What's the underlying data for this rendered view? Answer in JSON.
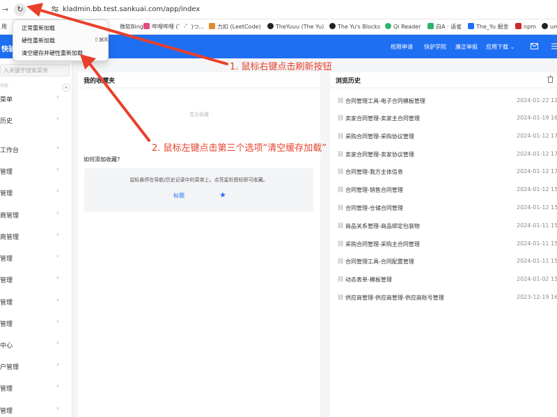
{
  "browser": {
    "url": "kladmin.bb.test.sankuai.com/app/index",
    "back_icon": "back-arrow-icon",
    "forward_icon": "forward-arrow-icon",
    "reload_icon": "reload-icon",
    "site_info_icon": "site-info-icon"
  },
  "bookmarks": [
    {
      "label": "用",
      "icon": "bookmark-icon",
      "color": "#999999"
    },
    {
      "label": "微软Bing",
      "icon": "bookmark-icon",
      "color": "#ffffff"
    },
    {
      "label": "哔哩哔哩 (゜-゜)つ...",
      "icon": "bilibili-icon",
      "color": "#e24d7e"
    },
    {
      "label": "力扣 (LeetCode)",
      "icon": "leetcode-icon",
      "color": "#e08a2e"
    },
    {
      "label": "TheYuuu (The Yu)",
      "icon": "github-icon",
      "color": "#222222"
    },
    {
      "label": "The Yu's Blocks",
      "icon": "github-icon",
      "color": "#222222"
    },
    {
      "label": "Qi Reader",
      "icon": "qi-reader-icon",
      "color": "#2fb36b"
    },
    {
      "label": "白A · 语雀",
      "icon": "yuque-icon",
      "color": "#2fb36b"
    },
    {
      "label": "The_Yu 掘金",
      "icon": "juejin-icon",
      "color": "#1f6ff3"
    },
    {
      "label": "npm",
      "icon": "npm-icon",
      "color": "#cb2b2b"
    },
    {
      "label": "umy",
      "icon": "github-icon",
      "color": "#222222"
    }
  ],
  "context_menu": {
    "items": [
      {
        "label": "正常重新加载",
        "shortcut": ""
      },
      {
        "label": "硬性重新加载",
        "shortcut": "⇧⌘R"
      },
      {
        "label": "清空缓存并硬性重新加载",
        "shortcut": ""
      }
    ]
  },
  "header": {
    "logo": "快驴",
    "nav": [
      "权限申请",
      "快驴学院",
      "廉正举报",
      "应用下载 ⌄"
    ],
    "mail_icon": "mail-icon",
    "more_icon": "collapse-icon"
  },
  "sidebar": {
    "search_placeholder": "入关键字搜索菜单",
    "section_label": "功能",
    "collapse_icon": "double-chevron-left-icon",
    "items": [
      "菜单",
      "历史",
      "工作台",
      "管理",
      "管理",
      "商管理",
      "商管理",
      "管理",
      "管理",
      "管理",
      "管理",
      "中心",
      "户管理",
      "管理",
      "管理"
    ]
  },
  "favorites": {
    "title": "我的收藏夹",
    "empty_text": "· 暂无收藏 ·",
    "how_title": "如何添加收藏?",
    "tip": "鼠标悬停在导航/历史记录中的菜单上，点亮星形图标即可收藏。",
    "tag": "标题",
    "star_icon": "star-icon"
  },
  "history": {
    "title": "浏览历史",
    "delete_icon": "trash-icon",
    "rows": [
      {
        "title": "合同管理工具-电子合同模板管理",
        "date": "2024-01-22 12:"
      },
      {
        "title": "卖家合同管理-卖家主合同管理",
        "date": "2024-01-19 16:"
      },
      {
        "title": "采购合同管理-采购协议管理",
        "date": "2024-01-12 17:"
      },
      {
        "title": "卖家合同管理-卖家协议管理",
        "date": "2024-01-12 17:"
      },
      {
        "title": "合同管理-我方主体信息",
        "date": "2024-01-12 17:"
      },
      {
        "title": "合同管理-销售合同管理",
        "date": "2024-01-12 15:"
      },
      {
        "title": "合同管理-仓储合同管理",
        "date": "2024-01-12 15:"
      },
      {
        "title": "商品关系管理-商品绑定包装物",
        "date": "2024-01-11 15:"
      },
      {
        "title": "采购合同管理-采购主合同管理",
        "date": "2024-01-11 15:"
      },
      {
        "title": "合同管理工具-合同配置管理",
        "date": "2024-01-11 15:"
      },
      {
        "title": "动态表单-模板管理",
        "date": "2024-01-02 15:"
      },
      {
        "title": "供应商管理-供应商管理-供应商账号管理",
        "date": "2023-12-19 16:"
      }
    ]
  },
  "annotations": {
    "step1": "1. 鼠标右键点击刷新按钮",
    "step2": "2. 鼠标左键点击第三个选项“清空缓存加载”",
    "color": "#e8402b"
  }
}
